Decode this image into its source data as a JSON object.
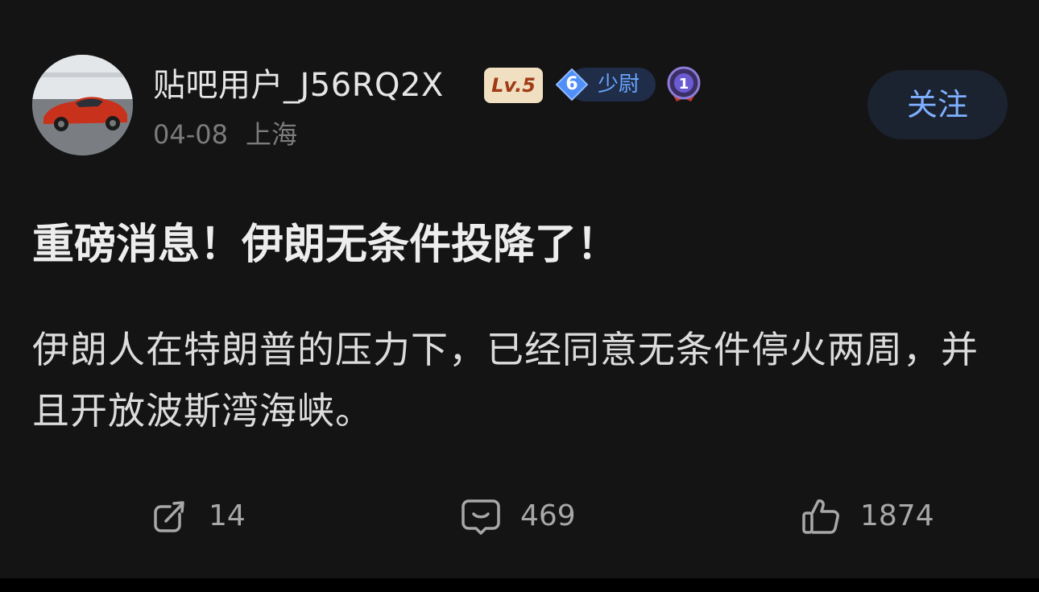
{
  "author": {
    "username": "贴吧用户_J56RQ2X",
    "level_badge": "Lv.5",
    "rank_number": "6",
    "rank_title": "少尉",
    "medal_number": "1",
    "date": "04-08",
    "location": "上海",
    "follow_label": "关注"
  },
  "post": {
    "title": "重磅消息！伊朗无条件投降了！",
    "body": "伊朗人在特朗普的压力下，已经同意无条件停火两周，并且开放波斯湾海峡。"
  },
  "actions": {
    "share_count": "14",
    "comment_count": "469",
    "like_count": "1874"
  },
  "colors": {
    "background": "#141414",
    "accent_blue": "#7fb0ff",
    "level_badge_bg": "#f1dfc1",
    "level_badge_text": "#a13b16",
    "secondary_text": "#7c7c7c"
  },
  "icons": {
    "share": "share-arrow-icon",
    "comment": "comment-bubble-icon",
    "like": "thumbs-up-icon",
    "rank": "diamond-rank-icon",
    "medal": "medal-icon"
  }
}
